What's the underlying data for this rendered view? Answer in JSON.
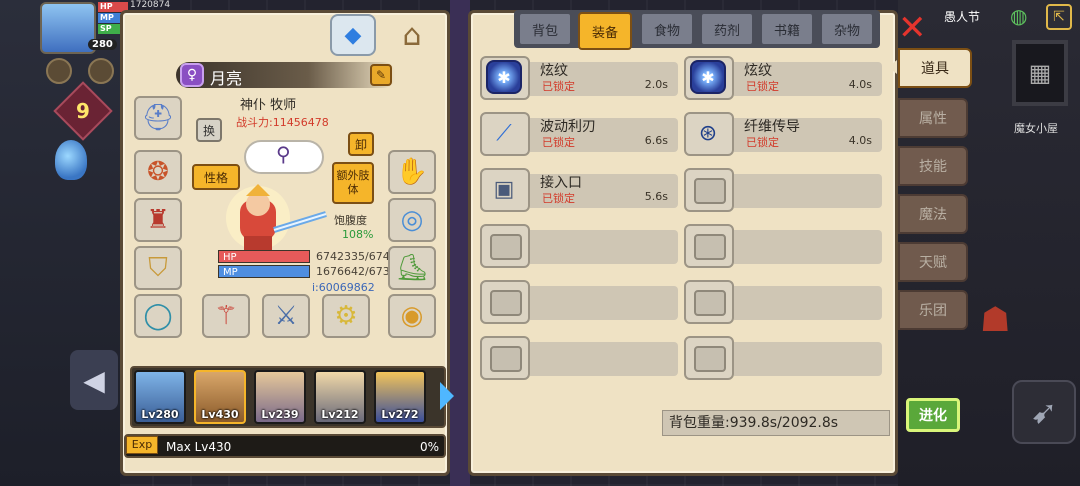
{
  "hud": {
    "level_badge": "280",
    "hp_label": "HP",
    "mp_label": "MP",
    "sp_label": "SP",
    "top_number": "1720874",
    "side_level": "9"
  },
  "header": {
    "close_icon": "close-icon",
    "holiday_text": "愚人节",
    "exit_icon": "exit-icon",
    "map_label": "魔女小屋"
  },
  "character": {
    "gender_icon": "♀",
    "name": "月亮",
    "class_title": "神仆 牧师",
    "power": "战斗力:11456478",
    "swap_label": "换",
    "unequip_label": "卸",
    "personality_label": "性格",
    "extra_limb_label": "额外肢体",
    "satiety_label": "饱腹度",
    "satiety_value": "108%",
    "hp_label": "HP",
    "mp_label": "MP",
    "hp_value": "6742335/674",
    "mp_value": "1676642/673",
    "exp_value": "i:60069862"
  },
  "party": [
    {
      "level": "Lv280"
    },
    {
      "level": "Lv430"
    },
    {
      "level": "Lv239"
    },
    {
      "level": "Lv212"
    },
    {
      "level": "Lv272"
    }
  ],
  "exp_bar": {
    "tag": "Exp",
    "text": "Max Lv430",
    "percent": "0%"
  },
  "tabs": [
    {
      "label": "背包",
      "active": false
    },
    {
      "label": "装备",
      "active": true
    },
    {
      "label": "食物",
      "active": false
    },
    {
      "label": "药剂",
      "active": false
    },
    {
      "label": "书籍",
      "active": false
    },
    {
      "label": "杂物",
      "active": false
    }
  ],
  "items": [
    {
      "name": "炫纹",
      "status": "已锁定",
      "cooldown": "2.0s",
      "icon": "gem-icon"
    },
    {
      "name": "炫纹",
      "status": "已锁定",
      "cooldown": "4.0s",
      "icon": "gem-icon"
    },
    {
      "name": "波动利刃",
      "status": "已锁定",
      "cooldown": "6.6s",
      "icon": "blade-icon"
    },
    {
      "name": "纤维传导",
      "status": "已锁定",
      "cooldown": "4.0s",
      "icon": "conduit-icon"
    },
    {
      "name": "接入口",
      "status": "已锁定",
      "cooldown": "5.6s",
      "icon": "port-icon"
    }
  ],
  "weight": "背包重量:939.8s/2092.8s",
  "side_tabs": [
    {
      "label": "道具",
      "active": true
    },
    {
      "label": "属性",
      "active": false
    },
    {
      "label": "技能",
      "active": false
    },
    {
      "label": "魔法",
      "active": false
    },
    {
      "label": "天赋",
      "active": false
    },
    {
      "label": "乐团",
      "active": false
    }
  ],
  "evolve_label": "进化"
}
